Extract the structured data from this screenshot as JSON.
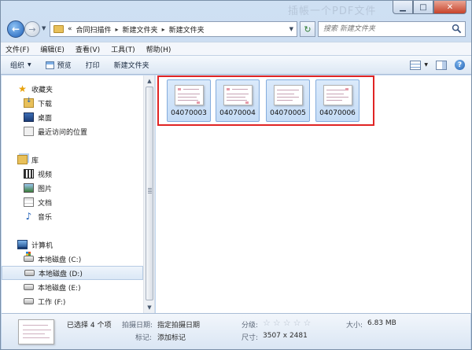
{
  "title_bar": {
    "watermark": "插帳一个PDF文件"
  },
  "address_bar": {
    "overflow": "«",
    "crumbs": [
      "合同扫描件",
      "新建文件夹",
      "新建文件夹"
    ]
  },
  "search": {
    "placeholder": "搜索 新建文件夹"
  },
  "menu": [
    "文件(F)",
    "编辑(E)",
    "查看(V)",
    "工具(T)",
    "帮助(H)"
  ],
  "toolbar": {
    "organize": "组织",
    "preview": "预览",
    "print": "打印",
    "new_folder": "新建文件夹"
  },
  "nav": {
    "favorites": {
      "label": "收藏夹",
      "items": [
        "下载",
        "桌面",
        "最近访问的位置"
      ]
    },
    "libraries": {
      "label": "库",
      "items": [
        "视频",
        "图片",
        "文档",
        "音乐"
      ]
    },
    "computer": {
      "label": "计算机",
      "drives": [
        "本地磁盘 (C:)",
        "本地磁盘 (D:)",
        "本地磁盘 (E:)",
        "工作 (F:)"
      ]
    }
  },
  "files": [
    "04070003",
    "04070004",
    "04070005",
    "04070006"
  ],
  "details": {
    "selection": "已选择 4 个项",
    "date_key": "拍摄日期:",
    "date_value": "指定拍摄日期",
    "tags_key": "标记:",
    "tags_value": "添加标记",
    "rating_key": "分级:",
    "dims_key": "尺寸:",
    "dims_value": "3507 x 2481",
    "size_key": "大小:",
    "size_value": "6.83 MB"
  }
}
